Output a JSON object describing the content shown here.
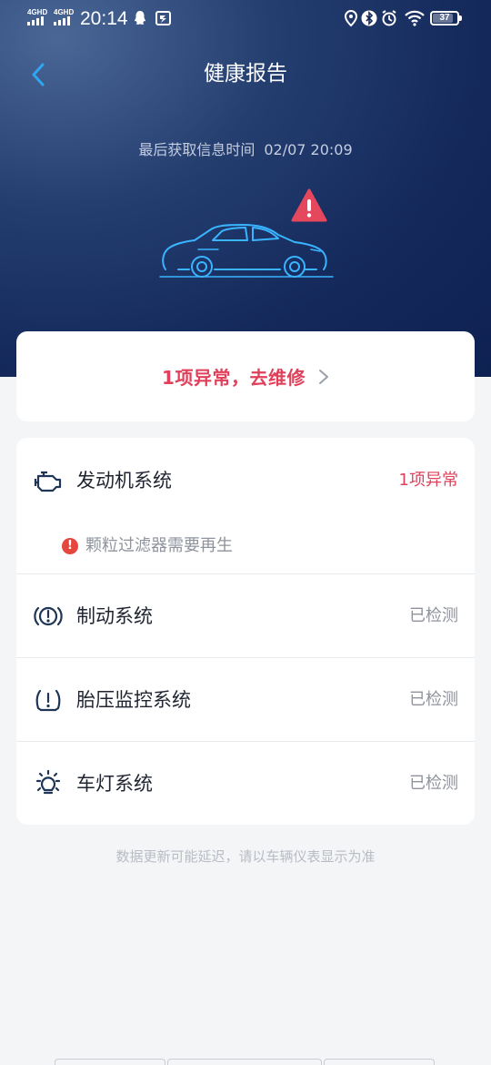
{
  "status_bar": {
    "network_1": "4GHD",
    "network_2": "4GHD",
    "time": "20:14",
    "battery": "37"
  },
  "header": {
    "title": "健康报告"
  },
  "info": {
    "last_fetch_label": "最后获取信息时间",
    "last_fetch_time": "02/07 20:09"
  },
  "repair": {
    "label": "1项异常，去维修"
  },
  "systems": [
    {
      "name": "发动机系统",
      "status": "1项异常",
      "icon": "engine-icon",
      "status_color": "#e0405a"
    },
    {
      "name": "制动系统",
      "status": "已检测",
      "icon": "brake-icon",
      "status_color": "#8e939c"
    },
    {
      "name": "胎压监控系统",
      "status": "已检测",
      "icon": "tire-pressure-icon",
      "status_color": "#8e939c"
    },
    {
      "name": "车灯系统",
      "status": "已检测",
      "icon": "light-icon",
      "status_color": "#8e939c"
    }
  ],
  "engine_alert": {
    "text": "颗粒过滤器需要再生"
  },
  "footer": {
    "note": "数据更新可能延迟，请以车辆仪表显示为准"
  },
  "colors": {
    "accent_red": "#e0405a",
    "hero_dark": "#0e2152",
    "back_blue": "#2ea7f0",
    "car_blue": "#3ab4ff"
  }
}
